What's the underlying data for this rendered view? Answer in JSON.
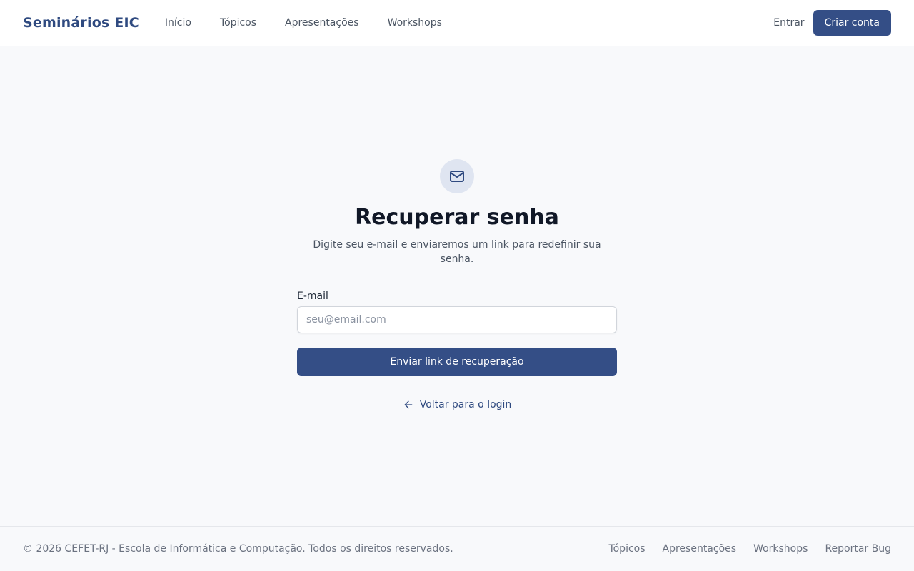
{
  "header": {
    "brand": "Seminários EIC",
    "nav": [
      {
        "label": "Início"
      },
      {
        "label": "Tópicos"
      },
      {
        "label": "Apresentações"
      },
      {
        "label": "Workshops"
      }
    ],
    "login_label": "Entrar",
    "signup_label": "Criar conta"
  },
  "form": {
    "icon": "mail-icon",
    "title": "Recuperar senha",
    "subtitle": "Digite seu e-mail e enviaremos um link para redefinir sua senha.",
    "email_label": "E-mail",
    "email_value": "",
    "email_placeholder": "seu@email.com",
    "submit_label": "Enviar link de recuperação",
    "back_icon": "arrow-left-icon",
    "back_label": "Voltar para o login"
  },
  "footer": {
    "copyright": "© 2026 CEFET-RJ - Escola de Informática e Computação. Todos os direitos reservados.",
    "links": [
      {
        "label": "Tópicos"
      },
      {
        "label": "Apresentações"
      },
      {
        "label": "Workshops"
      },
      {
        "label": "Reportar Bug"
      }
    ]
  },
  "colors": {
    "primary": "#344e86",
    "brand_text": "#2f4a80",
    "icon_bg": "#dfe5f1",
    "page_bg": "#f8f9fb"
  }
}
